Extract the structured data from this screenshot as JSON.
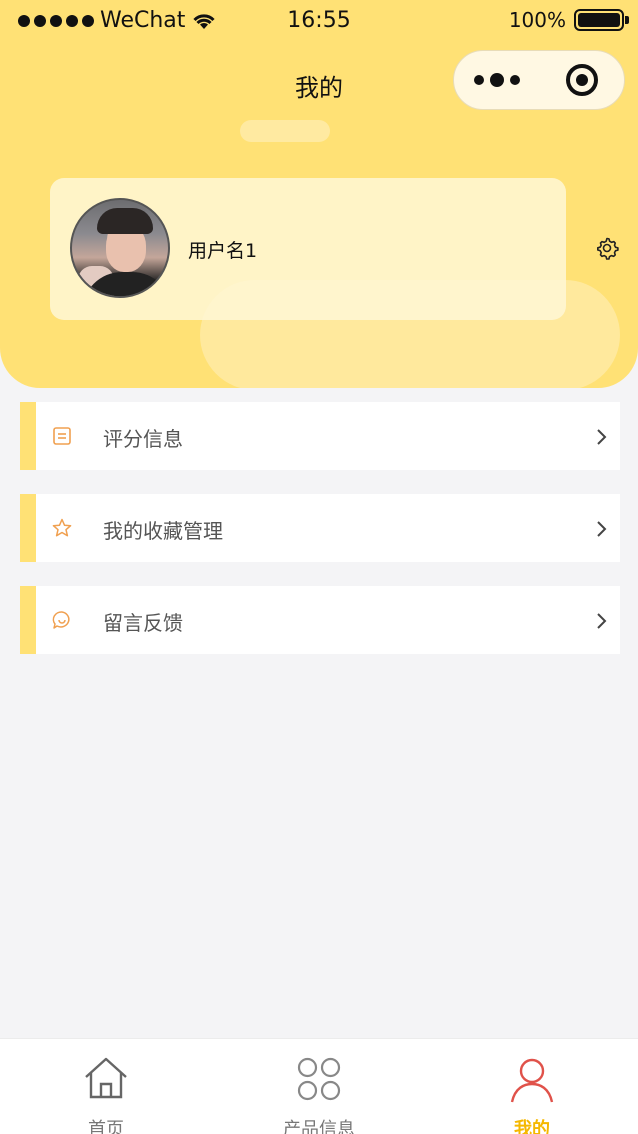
{
  "status_bar": {
    "carrier": "WeChat",
    "time": "16:55",
    "battery": "100%"
  },
  "nav": {
    "title": "我的"
  },
  "user": {
    "name": "用户名1"
  },
  "menu": [
    {
      "label": "评分信息",
      "icon": "document-icon"
    },
    {
      "label": "我的收藏管理",
      "icon": "star-icon"
    },
    {
      "label": "留言反馈",
      "icon": "chat-bubble-icon"
    }
  ],
  "tabbar": {
    "items": [
      {
        "label": "首页",
        "icon": "home-icon"
      },
      {
        "label": "产品信息",
        "icon": "grid-icon"
      },
      {
        "label": "我的",
        "icon": "user-icon",
        "active": true
      }
    ]
  },
  "colors": {
    "accent": "#ffe175",
    "active_tab": "#f5b800",
    "icon_orange": "#f0a050"
  }
}
